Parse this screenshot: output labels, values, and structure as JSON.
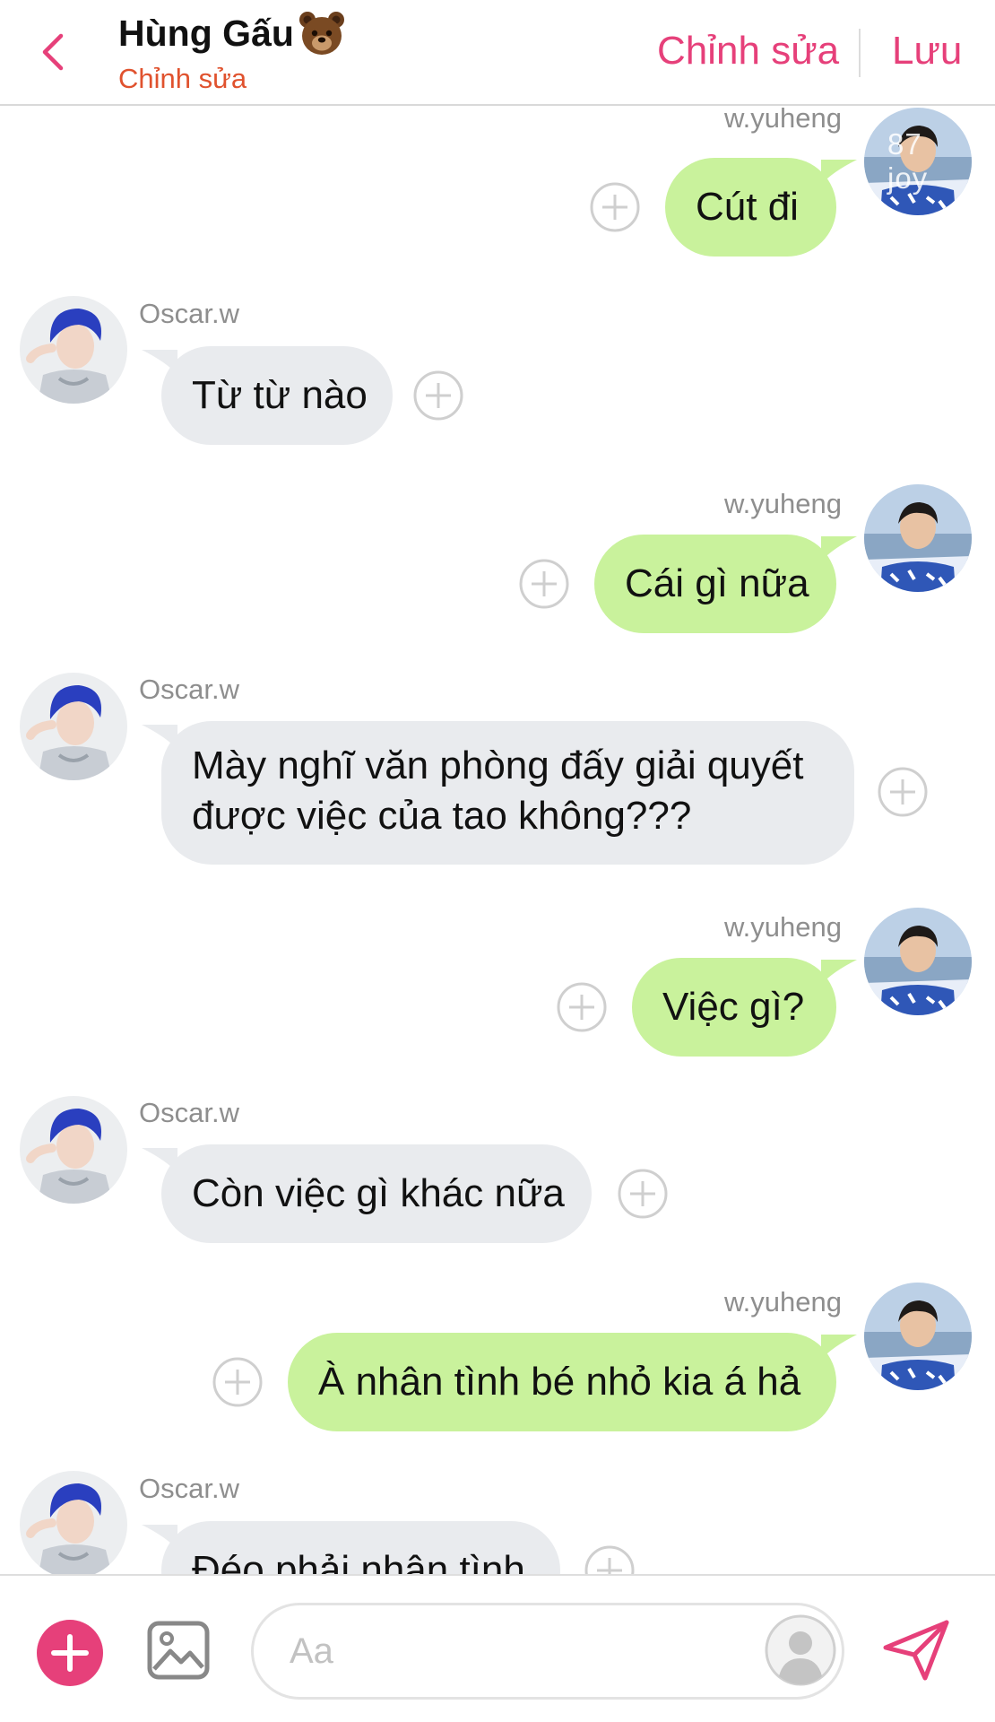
{
  "header": {
    "title": "Hùng Gấu",
    "subtitle": "Chỉnh sửa",
    "edit_label": "Chỉnh sửa",
    "save_label": "Lưu"
  },
  "messages": [
    {
      "side": "right",
      "sender": "w.yuheng",
      "text": "Cút đi",
      "avatar_watermark": "87 joy"
    },
    {
      "side": "left",
      "sender": "Oscar.w",
      "text": "Từ từ nào"
    },
    {
      "side": "right",
      "sender": "w.yuheng",
      "text": "Cái gì nữa"
    },
    {
      "side": "left",
      "sender": "Oscar.w",
      "text_lines": [
        "Mày nghĩ văn phòng đấy giải quyết",
        "được việc của tao không???"
      ]
    },
    {
      "side": "right",
      "sender": "w.yuheng",
      "text": "Việc gì?"
    },
    {
      "side": "left",
      "sender": "Oscar.w",
      "text": "Còn việc gì khác nữa"
    },
    {
      "side": "right",
      "sender": "w.yuheng",
      "text": "À nhân tình bé nhỏ kia á hả"
    },
    {
      "side": "left",
      "sender": "Oscar.w",
      "text": "Đéo phải nhân tình"
    }
  ],
  "composer": {
    "placeholder": "Aa",
    "value": ""
  },
  "icons": {
    "back": "chevron-left-icon",
    "title_emoji": "bear-face-icon",
    "add": "plus-circle-icon",
    "image": "image-icon",
    "sticker": "avatar-sticker-icon",
    "send": "paper-plane-icon",
    "message_action": "plus-outline-icon"
  },
  "colors": {
    "accent": "#e6407a",
    "subtitle": "#e0522e",
    "outgoing_bubble": "#c9f29c",
    "incoming_bubble": "#e9ebee",
    "sender_name": "#8e8e8e"
  }
}
